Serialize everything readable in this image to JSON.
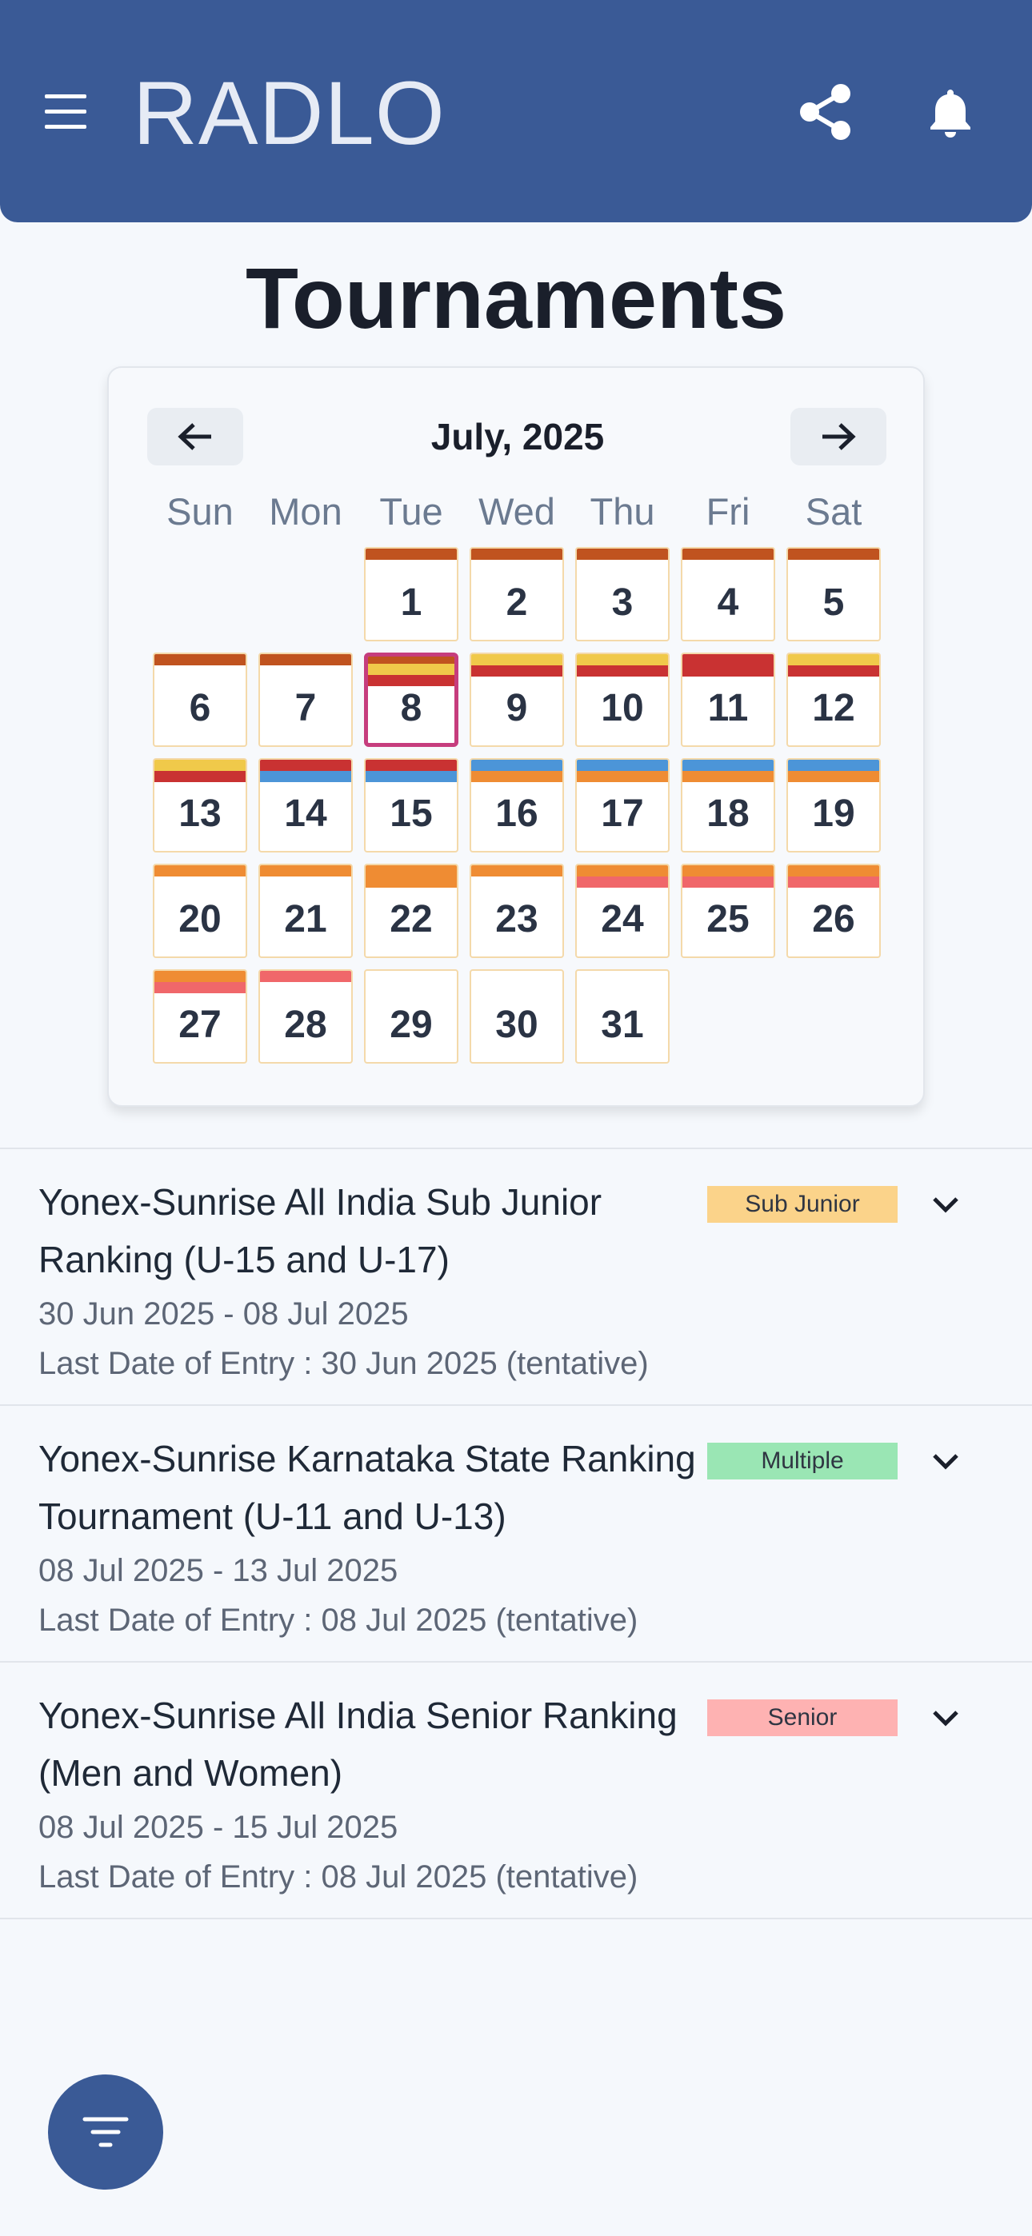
{
  "header": {
    "brand": "RADLO",
    "menu_icon": "hamburger-menu-icon",
    "share_icon": "share-icon",
    "notifications_icon": "bell-icon",
    "color": "#3a5a96"
  },
  "page": {
    "title": "Tournaments"
  },
  "calendar": {
    "month_label": "July, 2025",
    "prev_icon": "arrow-left-icon",
    "next_icon": "arrow-right-icon",
    "weekdays": [
      "Sun",
      "Mon",
      "Tue",
      "Wed",
      "Thu",
      "Fri",
      "Sat"
    ],
    "selected_day": "8",
    "event_colors": {
      "sub_junior": "#c0531f",
      "state_red": "#c93232",
      "yellow": "#f0c94a",
      "blue": "#4c95d8",
      "orange": "#ef8c33",
      "coral": "#f0676a"
    },
    "days": [
      {
        "label": "1"
      },
      {
        "label": "2"
      },
      {
        "label": "3"
      },
      {
        "label": "4"
      },
      {
        "label": "5"
      },
      {
        "label": "6"
      },
      {
        "label": "7"
      },
      {
        "label": "8"
      },
      {
        "label": "9"
      },
      {
        "label": "10"
      },
      {
        "label": "11"
      },
      {
        "label": "12"
      },
      {
        "label": "13"
      },
      {
        "label": "14"
      },
      {
        "label": "15"
      },
      {
        "label": "16"
      },
      {
        "label": "17"
      },
      {
        "label": "18"
      },
      {
        "label": "19"
      },
      {
        "label": "20"
      },
      {
        "label": "21"
      },
      {
        "label": "22"
      },
      {
        "label": "23"
      },
      {
        "label": "24"
      },
      {
        "label": "25"
      },
      {
        "label": "26"
      },
      {
        "label": "27"
      },
      {
        "label": "28"
      },
      {
        "label": "29"
      },
      {
        "label": "30"
      },
      {
        "label": "31"
      }
    ]
  },
  "tournaments": [
    {
      "title": "Yonex-Sunrise All India Sub Junior Ranking (U-15 and U-17)",
      "dates": "30 Jun 2025 - 08 Jul 2025",
      "entry": "Last Date of Entry : 30 Jun 2025 (tentative)",
      "badge": "Sub Junior",
      "badge_color": "#fbd38a"
    },
    {
      "title": "Yonex-Sunrise Karnataka State Ranking Tournament (U-11 and U-13)",
      "dates": "08 Jul 2025 - 13 Jul 2025",
      "entry": "Last Date of Entry : 08 Jul 2025 (tentative)",
      "badge": "Multiple",
      "badge_color": "#9ae6b4"
    },
    {
      "title": "Yonex-Sunrise All India Senior Ranking (Men and Women)",
      "dates": "08 Jul 2025 - 15 Jul 2025",
      "entry": "Last Date of Entry : 08 Jul 2025 (tentative)",
      "badge": "Senior",
      "badge_color": "#feb2b2"
    }
  ],
  "filter_button": {
    "icon": "filter-icon"
  }
}
